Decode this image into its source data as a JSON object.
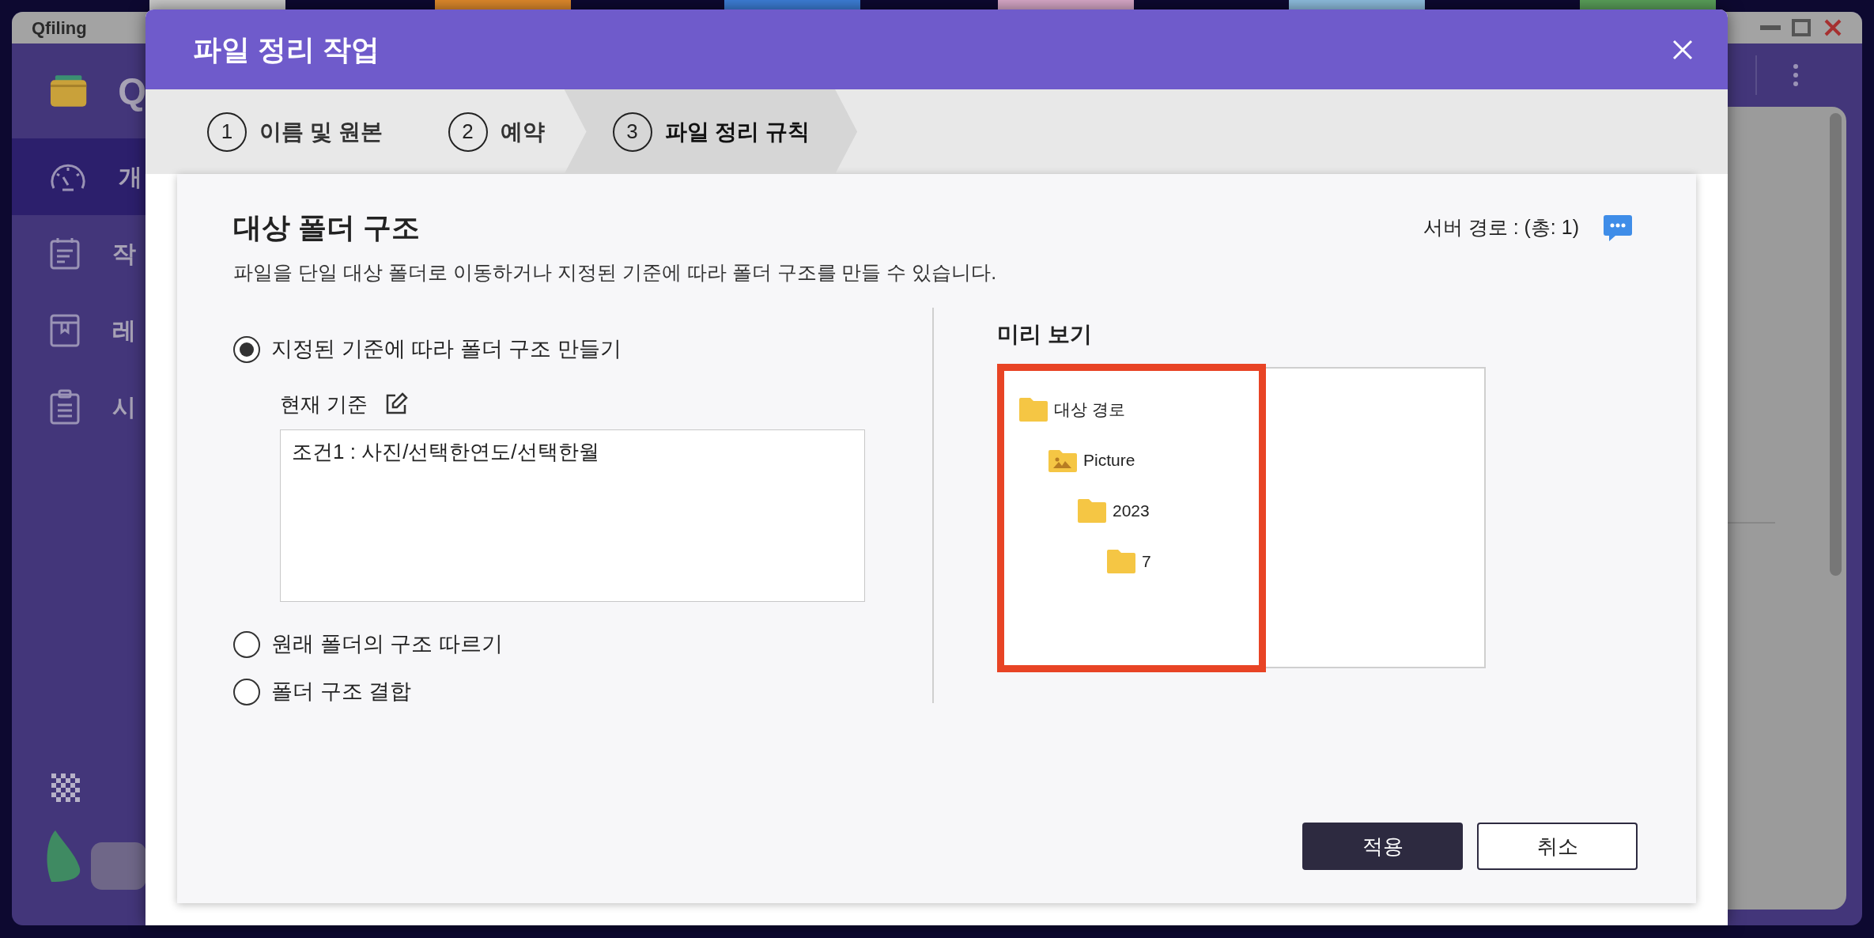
{
  "background_window": {
    "title": "Qfiling",
    "logo_text": "Q",
    "sidebar": {
      "items": [
        {
          "label": "개",
          "selected": true
        },
        {
          "label": "작",
          "selected": false
        },
        {
          "label": "레",
          "selected": false
        },
        {
          "label": "시",
          "selected": false
        }
      ]
    }
  },
  "dialog": {
    "title": "파일 정리 작업",
    "steps": [
      {
        "number": "1",
        "label": "이름 및 원본",
        "selected": false
      },
      {
        "number": "2",
        "label": "예약",
        "selected": false
      },
      {
        "number": "3",
        "label": "파일 정리 규칙",
        "selected": true
      }
    ],
    "section": {
      "title": "대상 폴더 구조",
      "description": "파일을 단일 대상 폴더로 이동하거나 지정된 기준에 따라 폴더 구조를 만들 수 있습니다.",
      "server_path": "서버 경로 : (총: 1)"
    },
    "options": [
      {
        "label": "지정된 기준에 따라 폴더 구조 만들기",
        "selected": true,
        "criteria": {
          "label": "현재 기준",
          "value": "조건1 : 사진/선택한연도/선택한월"
        }
      },
      {
        "label": "원래 폴더의 구조 따르기",
        "selected": false
      },
      {
        "label": "폴더 구조 결합",
        "selected": false
      }
    ],
    "preview": {
      "title": "미리 보기",
      "tree": [
        {
          "name": "대상 경로",
          "kind": "folder",
          "children": [
            {
              "name": "Picture",
              "kind": "picture-folder",
              "children": [
                {
                  "name": "2023",
                  "kind": "folder",
                  "children": [
                    {
                      "name": "7",
                      "kind": "folder"
                    }
                  ]
                }
              ]
            }
          ]
        }
      ]
    },
    "buttons": [
      {
        "label": "적용",
        "kind": "primary"
      },
      {
        "label": "취소",
        "kind": "secondary"
      }
    ]
  }
}
